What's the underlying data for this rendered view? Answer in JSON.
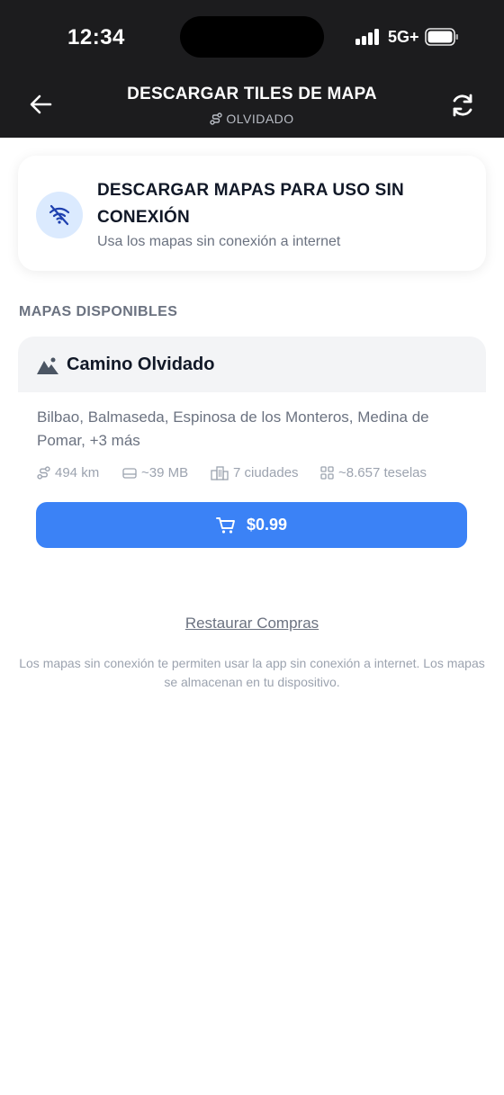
{
  "status_bar": {
    "time": "12:34",
    "network": "5G+"
  },
  "header": {
    "title": "DESCARGAR TILES DE MAPA",
    "subtitle": "OLVIDADO",
    "back_icon": "arrow-left-icon",
    "refresh_icon": "refresh-icon"
  },
  "info_card": {
    "title": "DESCARGAR MAPAS PARA USO SIN CONEXIÓN",
    "subtitle": "Usa los mapas sin conexión a internet",
    "icon": "wifi-off-icon"
  },
  "section_label": "MAPAS DISPONIBLES",
  "map": {
    "name": "Camino Olvidado",
    "cities": "Bilbao, Balmaseda, Espinosa de los Monteros, Medina de Pomar, +3 más",
    "stats": {
      "distance": "494 km",
      "size": "~39 MB",
      "cities_count": "7 ciudades",
      "tiles": "~8.657 teselas"
    },
    "price": "$0.99"
  },
  "restore_label": "Restaurar Compras",
  "footnote": "Los mapas sin conexión te permiten usar la app sin conexión a internet. Los mapas se almacenan en tu dispositivo.",
  "colors": {
    "accent": "#3b82f6",
    "header_bg": "#1c1c1e",
    "icon_bg": "#dbeafe"
  }
}
